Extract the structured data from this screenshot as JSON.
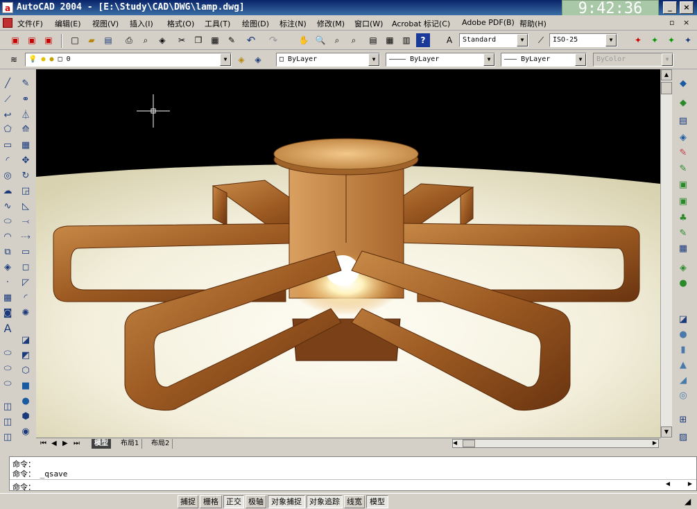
{
  "window": {
    "title": "AutoCAD 2004 - [E:\\Study\\CAD\\DWG\\lamp.dwg]",
    "app_icon": "a",
    "clock": "9:42:36"
  },
  "menu": [
    "文件(F)",
    "编辑(E)",
    "视图(V)",
    "插入(I)",
    "格式(O)",
    "工具(T)",
    "绘图(D)",
    "标注(N)",
    "修改(M)",
    "窗口(W)",
    "Acrobat 标记(C)",
    "Adobe PDF(B)",
    "帮助(H)"
  ],
  "toolbar": {
    "text_style": "Standard",
    "dim_style": "ISO-25"
  },
  "layers": {
    "current_layer": "0",
    "color": "ByLayer",
    "linetype": "ByLayer",
    "lineweight": "ByLayer",
    "plotstyle": "ByColor"
  },
  "tabs": [
    "模型",
    "布局1",
    "布局2"
  ],
  "command": {
    "line1": "命令：",
    "line2": "命令： _qsave",
    "prompt": "命令："
  },
  "status": [
    "捕捉",
    "栅格",
    "正交",
    "极轴",
    "对象捕捉",
    "对象追踪",
    "线宽",
    "模型"
  ],
  "icons": {
    "save": "save-icon",
    "undo": "undo-icon",
    "redo": "redo-icon",
    "help": "help-icon"
  }
}
